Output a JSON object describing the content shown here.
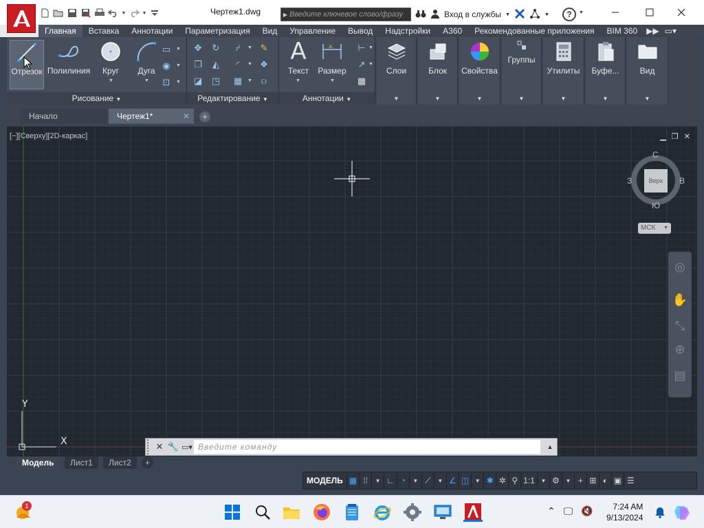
{
  "title_bar": {
    "doc_title": "Чертеж1.dwg",
    "search_placeholder": "Введите ключевое слово/фразу",
    "login_label": "Вход в службы",
    "help_label": "?"
  },
  "ribbon_tabs": [
    "Главная",
    "Вставка",
    "Аннотации",
    "Параметризация",
    "Вид",
    "Управление",
    "Вывод",
    "Надстройки",
    "A360",
    "Рекомендованные приложения",
    "BIM 360"
  ],
  "ribbon": {
    "draw": {
      "title": "Рисование",
      "tools": [
        "Отрезок",
        "Полилиния",
        "Круг",
        "Дуга"
      ]
    },
    "modify": {
      "title": "Редактирование"
    },
    "annotation": {
      "title": "Аннотации",
      "tools": [
        "Текст",
        "Размер"
      ]
    },
    "panels": [
      "Слои",
      "Блок",
      "Свойства",
      "Группы",
      "Утилиты",
      "Буфе...",
      "Вид"
    ]
  },
  "file_tabs": {
    "start": "Начало",
    "drawing": "Чертеж1*"
  },
  "viewport": {
    "label": "[−][Сверху][2D-каркас]",
    "viewcube": {
      "face": "Верх",
      "north": "С",
      "south": "Ю",
      "west": "З",
      "east": "В"
    },
    "wcs": "МСК",
    "ucs_x": "X",
    "ucs_y": "Y"
  },
  "command_line": {
    "placeholder": "Введите команду"
  },
  "layout_tabs": [
    "Модель",
    "Лист1",
    "Лист2"
  ],
  "status_bar": {
    "model": "МОДЕЛЬ",
    "scale": "1:1"
  },
  "taskbar": {
    "weather_badge": "1",
    "time": "7:24 AM",
    "date": "9/13/2024"
  },
  "colors": {
    "ribbon_bg": "#464e5b",
    "canvas_bg": "#212830",
    "autocad_red": "#c91d23",
    "status_active": "#43a5ff"
  }
}
